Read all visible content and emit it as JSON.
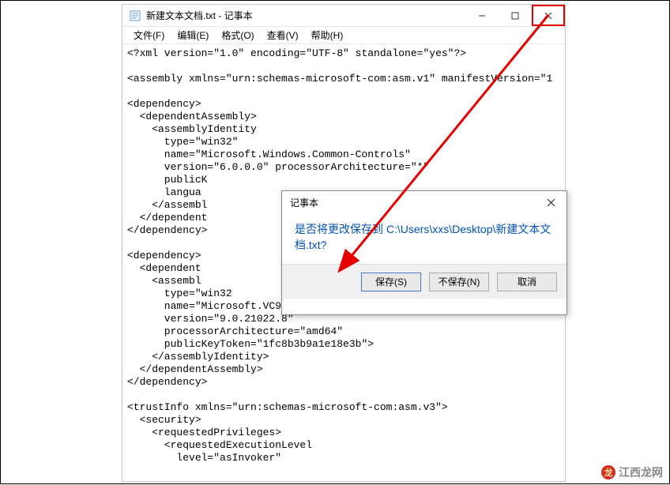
{
  "window": {
    "title": "新建文本文档.txt - 记事本"
  },
  "menu": {
    "file": "文件(F)",
    "edit": "编辑(E)",
    "format": "格式(O)",
    "view": "查看(V)",
    "help": "帮助(H)"
  },
  "editor": {
    "content": "<?xml version=\"1.0\" encoding=\"UTF-8\" standalone=\"yes\"?>\n\n<assembly xmlns=\"urn:schemas-microsoft-com:asm.v1\" manifestVersion=\"1\n\n<dependency>\n  <dependentAssembly>\n    <assemblyIdentity\n      type=\"win32\"\n      name=\"Microsoft.Windows.Common-Controls\"\n      version=\"6.0.0.0\" processorArchitecture=\"*\"\n      publicK\n      langua\n    </assembl\n  </dependent\n</dependency>\n\n<dependency>\n  <dependent\n    <assembl\n      type=\"win32\n      name=\"Microsoft.VC90.CRT\"\n      version=\"9.0.21022.8\"\n      processorArchitecture=\"amd64\"\n      publicKeyToken=\"1fc8b3b9a1e18e3b\">\n    </assemblyIdentity>\n  </dependentAssembly>\n</dependency>\n\n<trustInfo xmlns=\"urn:schemas-microsoft-com:asm.v3\">\n  <security>\n    <requestedPrivileges>\n      <requestedExecutionLevel\n        level=\"asInvoker\""
  },
  "dialog": {
    "title": "记事本",
    "message": "是否将更改保存到 C:\\Users\\xxs\\Desktop\\新建文本文档.txt?",
    "save": "保存(S)",
    "dontsave": "不保存(N)",
    "cancel": "取消"
  },
  "watermark": {
    "text": "江西龙网",
    "icon": "龙"
  }
}
